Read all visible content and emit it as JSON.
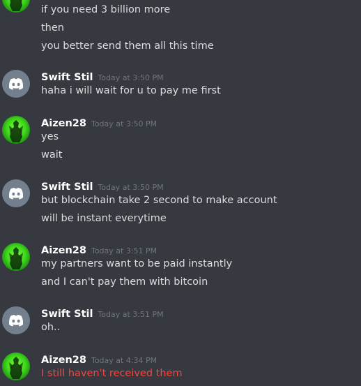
{
  "messages": [
    {
      "author": "",
      "avatar": "aizen-avatar",
      "timestamp": "",
      "lines": [
        {
          "text": "if you need 3 billion more"
        },
        {
          "text": "then"
        },
        {
          "text": "you better send them all this time"
        }
      ]
    },
    {
      "author": "Swift Stil",
      "avatar": "discord-logo-icon",
      "timestamp": "Today at 3:50 PM",
      "lines": [
        {
          "text": "haha i will wait for u to pay me first"
        }
      ]
    },
    {
      "author": "Aizen28",
      "avatar": "aizen-avatar",
      "timestamp": "Today at 3:50 PM",
      "lines": [
        {
          "text": "yes"
        },
        {
          "text": "wait"
        }
      ]
    },
    {
      "author": "Swift Stil",
      "avatar": "discord-logo-icon",
      "timestamp": "Today at 3:50 PM",
      "lines": [
        {
          "text": "but blockchain take 2 second to make account"
        },
        {
          "text": "will be instant everytime"
        }
      ]
    },
    {
      "author": "Aizen28",
      "avatar": "aizen-avatar",
      "timestamp": "Today at 3:51 PM",
      "lines": [
        {
          "text": "my partners want to be paid instantly"
        },
        {
          "text": "and I can't pay them with bitcoin"
        }
      ]
    },
    {
      "author": "Swift Stil",
      "avatar": "discord-logo-icon",
      "timestamp": "Today at 3:51 PM",
      "lines": [
        {
          "text": "oh.."
        }
      ]
    },
    {
      "author": "Aizen28",
      "avatar": "aizen-avatar",
      "timestamp": "Today at 4:34 PM",
      "lines": [
        {
          "text": "I still haven't received them",
          "status": "failed"
        }
      ]
    }
  ],
  "colors": {
    "background": "#36393f",
    "username": "#ffffff",
    "message_text": "#dcddde",
    "timestamp": "#72767d",
    "failed_message": "#f04747",
    "default_avatar_bg": "#747f8d",
    "aizen_avatar_green": "#3fd81c"
  }
}
